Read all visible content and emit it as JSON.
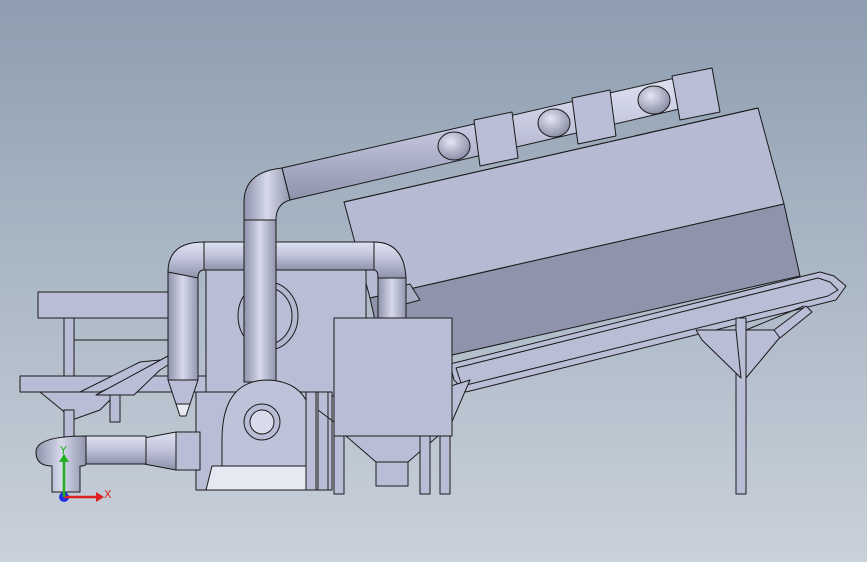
{
  "viewport": {
    "background_top": "#8e9eb0",
    "background_bottom": "#c9d1da",
    "model_color": "#b9bdd6",
    "shadow_color": "#8f93ab",
    "edge_color": "#1a1a1a"
  },
  "triad": {
    "x_label": "X",
    "y_label": "Y",
    "x_color": "#e02020",
    "y_color": "#20b020",
    "z_color": "#2030e0"
  }
}
